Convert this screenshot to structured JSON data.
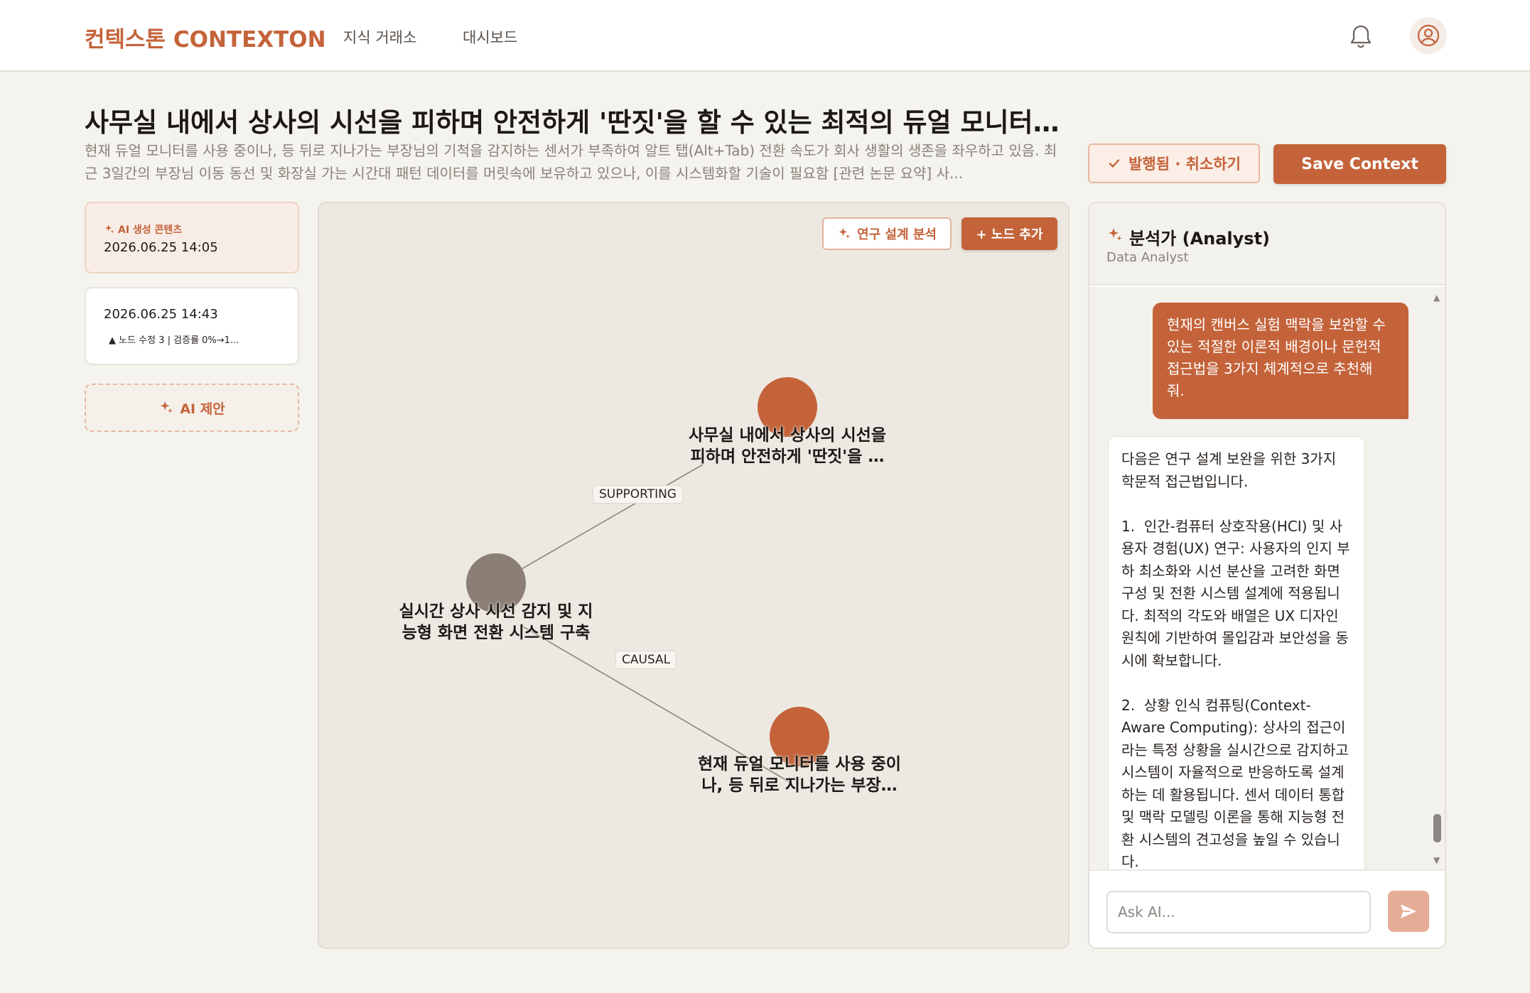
{
  "header": {
    "logo": "컨텍스톤 CONTEXTON",
    "nav": [
      "지식 거래소",
      "대시보드"
    ]
  },
  "page": {
    "title": "사무실 내에서 상사의 시선을 피하며 안전하게 '딴짓'을 할 수 있는 최적의 듀얼 모니터 각...",
    "description": "현재 듀얼 모니터를 사용 중이나, 등 뒤로 지나가는 부장님의 기척을 감지하는 센서가 부족하여 알트 탭(Alt+Tab) 전환 속도가 회사 생활의 생존을 좌우하고 있음. 최근 3일간의 부장님 이동 동선 및 화장실 가는 시간대 패턴 데이터를 머릿속에 보유하고 있으나, 이를 시스템화할 기술이 필요함 [관련 논문 요약] 사..."
  },
  "actions": {
    "published_label": "발행됨 · 취소하기",
    "save_label": "Save Context"
  },
  "versions": [
    {
      "tag": "AI 생성 콘텐츠",
      "date": "2026.06.25 14:05"
    },
    {
      "date": "2026.06.25 14:43",
      "diff": "▲ 노드 수정 3 | 검증률 0%→1..."
    }
  ],
  "ai_suggest_label": "AI 제안",
  "canvas": {
    "research_label": "연구 설계 분석",
    "add_node_label": "+ 노드 추가",
    "nodes": [
      {
        "label_line1": "사무실 내에서 상사의 시선을",
        "label_line2": "피하며 안전하게 '딴짓'을 …"
      },
      {
        "label_line1": "실시간 상사 시선 감지 및 지",
        "label_line2": "능형 화면 전환 시스템 구축"
      },
      {
        "label_line1": "현재 듀얼 모니터를 사용 중이",
        "label_line2": "나, 등 뒤로 지나가는 부장…"
      }
    ],
    "edges": [
      "SUPPORTING",
      "CAUSAL"
    ],
    "colors": {
      "accent": "#c4633a",
      "neutral": "#8b7f75"
    }
  },
  "chat": {
    "title": "분석가 (Analyst)",
    "subtitle": "Data Analyst",
    "user_message": "현재의 캔버스 실험 맥락을 보완할 수 있는 적절한 이론적 배경이나 문헌적 접근법을 3가지 체계적으로 추천해 줘.",
    "ai_message": "다음은 연구 설계 보완을 위한 3가지 학문적 접근법입니다.\n\n1.  인간-컴퓨터 상호작용(HCI) 및 사용자 경험(UX) 연구: 사용자의 인지 부하 최소화와 시선 분산을 고려한 화면 구성 및 전환 시스템 설계에 적용됩니다. 최적의 각도와 배열은 UX 디자인 원칙에 기반하여 몰입감과 보안성을 동시에 확보합니다.\n\n2.  상황 인식 컴퓨팅(Context-Aware Computing): 상사의 접근이라는 특정 상황을 실시간으로 감지하고 시스템이 자율적으로 반응하도록 설계하는 데 활용됩니다. 센서 데이터 통합 및 맥락 모델링 이론을 통해 지능형 전환 시스템의 견고성을 높일 수 있습니다.",
    "input_placeholder": "Ask AI..."
  }
}
